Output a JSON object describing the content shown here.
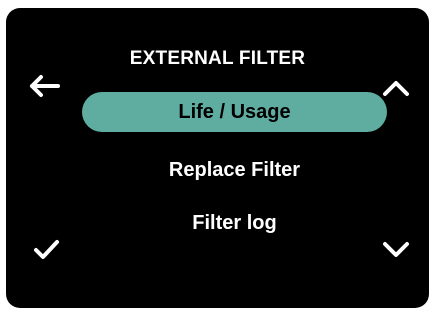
{
  "screen": {
    "title": "EXTERNAL FILTER"
  },
  "menu": {
    "items": [
      {
        "label": "Life / Usage",
        "selected": true
      },
      {
        "label": "Replace Filter",
        "selected": false
      },
      {
        "label": "Filter log",
        "selected": false
      }
    ]
  },
  "controls": {
    "back": {
      "icon": "arrow-left-icon"
    },
    "up": {
      "icon": "chevron-up-icon"
    },
    "confirm": {
      "icon": "checkmark-icon"
    },
    "down": {
      "icon": "chevron-down-icon"
    }
  },
  "colors": {
    "background": "#000000",
    "text": "#ffffff",
    "highlight": "#5fada1",
    "selected_text": "#000000"
  }
}
